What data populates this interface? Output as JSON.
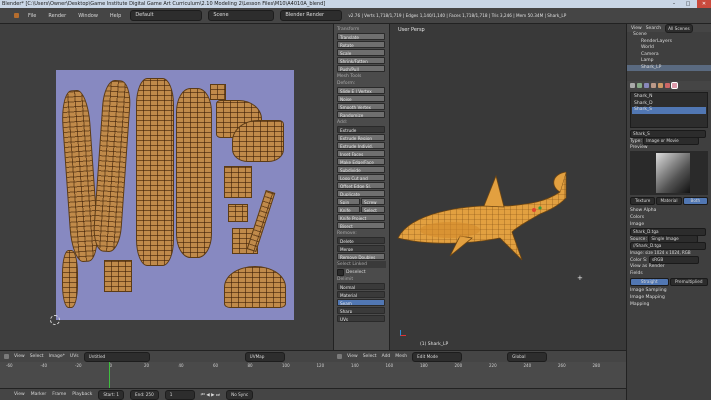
{
  "window": {
    "title": "Blender* [C:\\Users\\Owner\\Desktop\\Game Institute Digital Game Art Curriculum\\2.10 Modeling 2\\Lesson Files\\M10\\A4010A_blend]"
  },
  "info_bar": {
    "menus": [
      "File",
      "Render",
      "Window",
      "Help"
    ],
    "layout": "Default",
    "scene": "Scene",
    "engine": "Blender Render",
    "stats": "v2.76 | Verts 1,718/1,719 | Edges 1,140/1,140 | Faces 1,718/1,718 | Tris 3,246 | Mem 50.34M | Shark_LP"
  },
  "tool_shelf": {
    "transform_header": "Transform",
    "transform_tools": [
      "Translate",
      "Rotate",
      "Scale",
      "Shrink/Fatten",
      "Push/Pull"
    ],
    "mesh_tools_header": "Mesh Tools",
    "deform_header": "Deform:",
    "deform_tools": [
      "Slide E | Vertex",
      "Noise",
      "Smooth Vertex",
      "Randomize"
    ],
    "add_header": "Add:",
    "add_tools": [
      "Extrude",
      "Extrude Region",
      "Extrude Individ.",
      "Inset Faces",
      "Make Edge/Face",
      "Subdivide",
      "Loop Cut and",
      "Offset Edge Sl.",
      "Duplicate",
      "Spin",
      "Screw",
      "Knife",
      "Select",
      "Knife Project",
      "Bisect"
    ],
    "remove_header": "Remove:",
    "remove_tools": [
      "Delete",
      "Merge",
      "Remove Doubles"
    ],
    "select_linked_header": "Select Linked",
    "deselect_label": "Deselect",
    "delimit_header": "Delimit",
    "delimit_options": [
      "Normal",
      "Material",
      "Seam",
      "Sharp",
      "UVs"
    ]
  },
  "viewport": {
    "view_label": "User Persp",
    "object_label": "(1) Shark_LP"
  },
  "outliner": {
    "tabs": [
      "View",
      "Search",
      "All Scenes"
    ],
    "items": [
      "Scene",
      "RenderLayers",
      "World",
      "Camera",
      "Lamp",
      "Shark_LP"
    ]
  },
  "properties": {
    "textures": [
      "Shark_N",
      "Shark_D",
      "Shark_S"
    ],
    "selected_texture": "Shark_S",
    "texture_name": "Shark_S",
    "type_label": "Type:",
    "type_value": "Image or Movie",
    "preview_header": "Preview",
    "preview_tabs": [
      "Texture",
      "Material",
      "Both"
    ],
    "show_alpha": "Show Alpha",
    "colors_header": "Colors",
    "image_header": "Image",
    "image_name": "Shark_D.tga",
    "source_label": "Source:",
    "source_value": "Single Image",
    "filepath": "//Shark_D.tga",
    "image_info": "Image: size 1024 x 1024, RGB",
    "color_space_label": "Color S:",
    "color_space_value": "sRGB",
    "view_as_render": "View as Render",
    "fields": "Fields",
    "alpha_tabs": [
      "Straight",
      "Premultiplied"
    ],
    "sections": [
      "Image Sampling",
      "Image Mapping",
      "Mapping"
    ]
  },
  "uv_header": {
    "menus": [
      "View",
      "Select",
      "Image*",
      "UVs"
    ],
    "image_name": "Untitled",
    "uvmap": "UVMap"
  },
  "viewport_header": {
    "menus": [
      "View",
      "Select",
      "Add",
      "Mesh"
    ],
    "mode": "Edit Mode",
    "orientation": "Global"
  },
  "timeline": {
    "ticks": [
      "-60",
      "-40",
      "-20",
      "0",
      "20",
      "40",
      "60",
      "80",
      "100",
      "120",
      "140",
      "160",
      "180",
      "200",
      "220",
      "240",
      "260",
      "280"
    ],
    "menus": [
      "View",
      "Marker",
      "Frame",
      "Playback"
    ],
    "start": "Start:",
    "start_value": "1",
    "end": "End:",
    "end_value": "250",
    "current_frame": "1",
    "sync": "No Sync"
  },
  "colors": {
    "uv_background": "#8789c1",
    "uv_island": "#c08a4a",
    "selected_blue": "#5177b3",
    "shark_orange": "#e2a040"
  }
}
